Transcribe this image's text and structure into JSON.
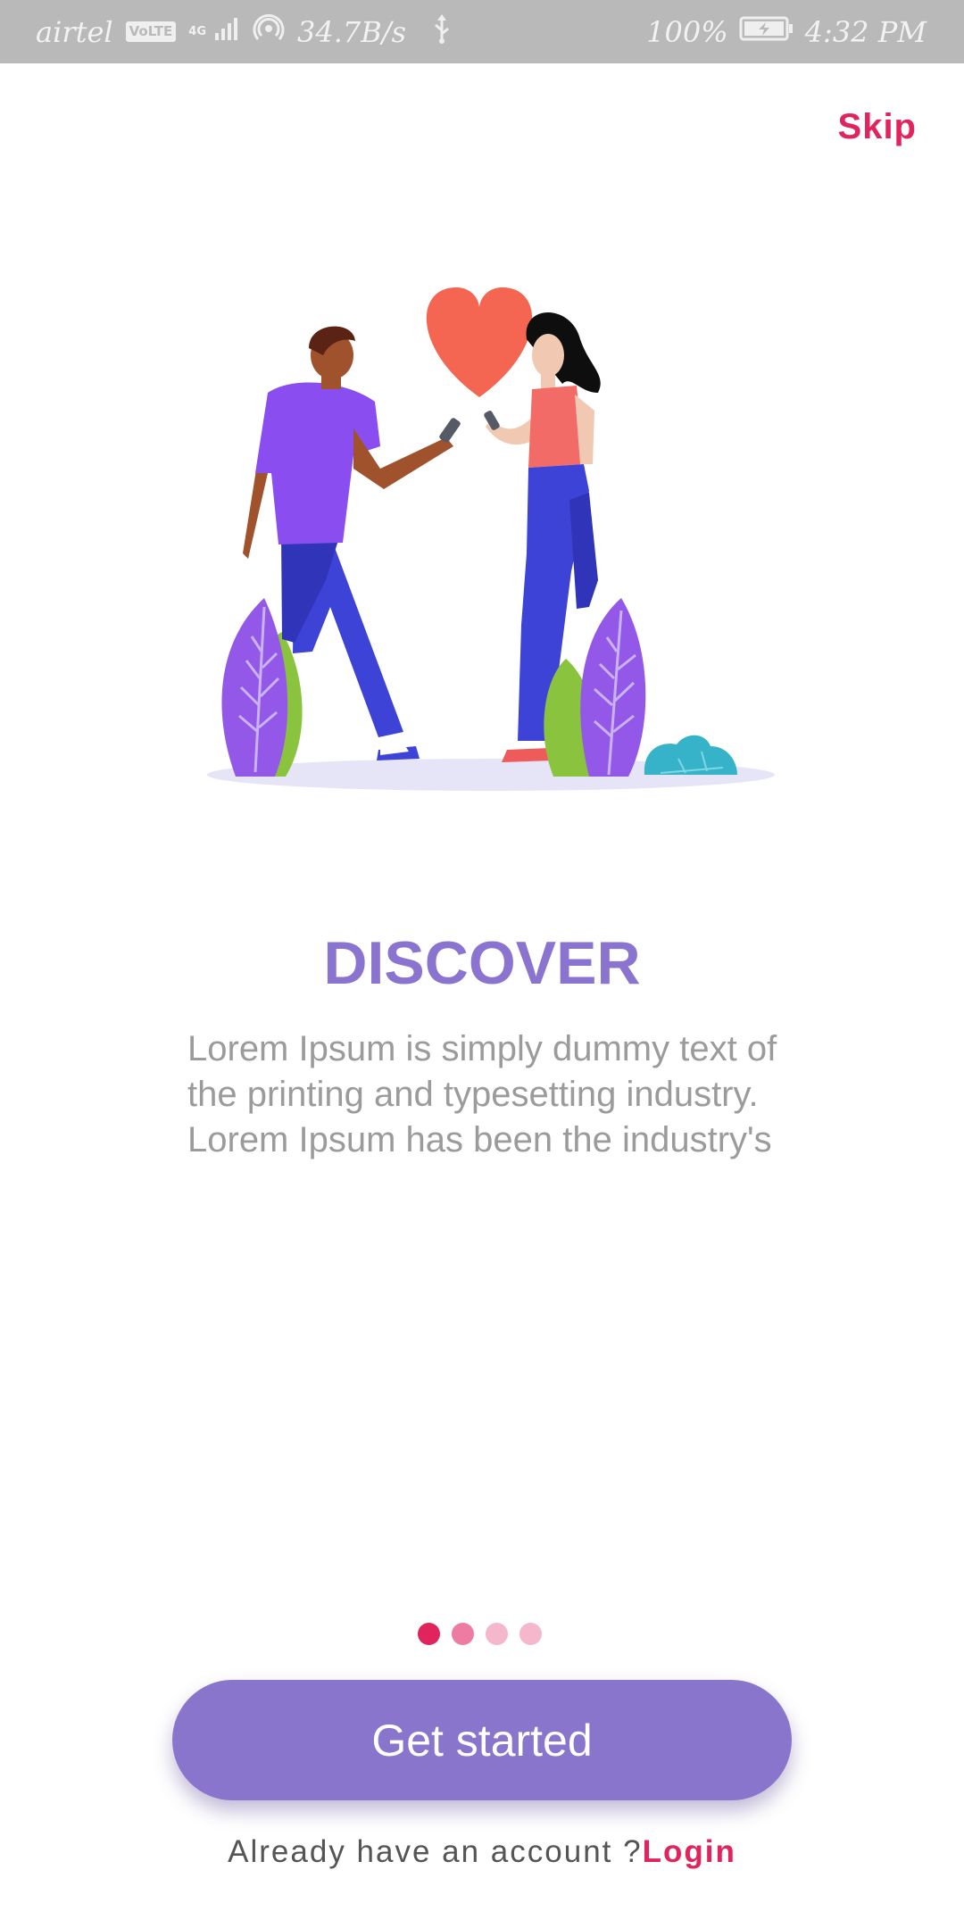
{
  "status_bar": {
    "carrier": "airtel",
    "volte": "VoLTE",
    "network_type": "4G",
    "speed": "34.7B/s",
    "battery": "100%",
    "time": "4:32 PM"
  },
  "header": {
    "skip_label": "Skip"
  },
  "content": {
    "title": "DISCOVER",
    "lines": [
      "Lorem Ipsum is simply dummy text of",
      "the printing and typesetting industry.",
      "Lorem Ipsum has been the industry's"
    ]
  },
  "pager": {
    "page_count": 4,
    "current_page": 1,
    "colors": [
      "#e0245e",
      "#ee7ba2",
      "#f4b7cb",
      "#f4b7cb"
    ]
  },
  "actions": {
    "get_started_label": "Get started",
    "login_prompt": "Already have an account ?",
    "login_label": "Login"
  },
  "colors": {
    "accent": "#e0245e",
    "primary": "#8a75cd",
    "title": "#8a74cf",
    "status_bar": "#b9b9b9"
  }
}
